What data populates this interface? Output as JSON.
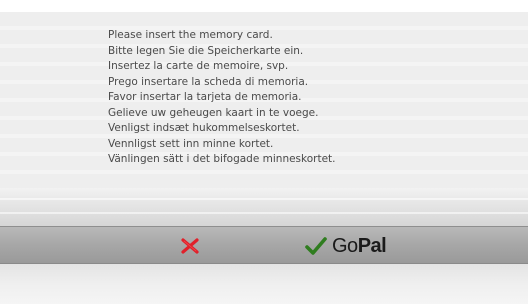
{
  "dialog": {
    "messages": [
      "Please insert the memory card.",
      "Bitte legen Sie die Speicherkarte ein.",
      "Insertez la carte de memoire, svp.",
      "Prego insertare la scheda di memoria.",
      "Favor insertar la tarjeta de memoria.",
      "Gelieve uw geheugen kaart in te voege.",
      "Venligst indsæt hukommelseskortet.",
      "Vennligst sett inn minne kortet.",
      "Vänlingen sätt i det bifogade minneskortet."
    ]
  },
  "buttons": {
    "cancel": {
      "icon": "red-x-icon",
      "color": "#e0202a"
    },
    "confirm": {
      "icon": "green-checkmark-icon",
      "color": "#2f7d1f"
    }
  },
  "brand": {
    "name_regular": "Go",
    "name_bold": "Pal"
  }
}
